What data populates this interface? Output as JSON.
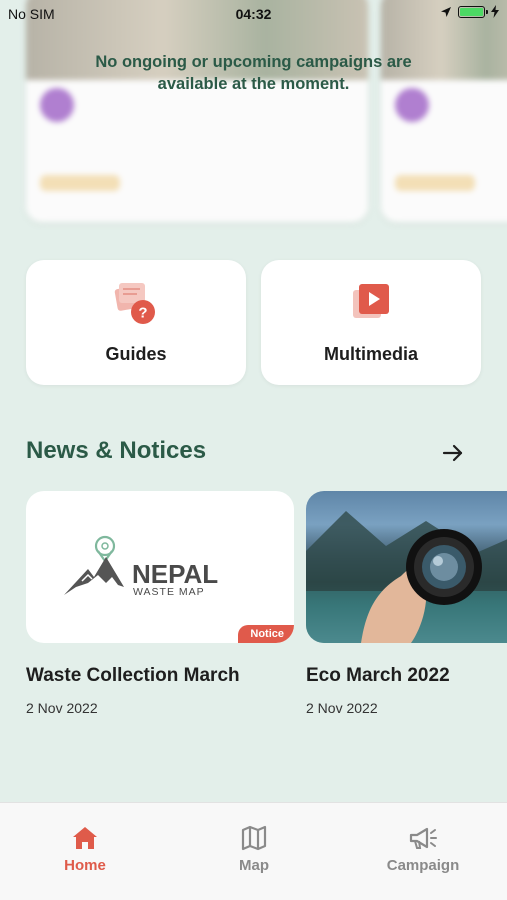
{
  "status_bar": {
    "carrier": "No SIM",
    "time": "04:32",
    "battery_level": 1.0
  },
  "campaigns": {
    "empty_message": "No ongoing or upcoming campaigns are available at the moment."
  },
  "quick_links": [
    {
      "label": "Guides",
      "icon": "guide-question-icon"
    },
    {
      "label": "Multimedia",
      "icon": "video-play-icon"
    }
  ],
  "news": {
    "section_title": "News & Notices",
    "more_icon": "arrow-right-icon",
    "items": [
      {
        "title": "Waste Collection March",
        "date": "2 Nov 2022",
        "badge": "Notice",
        "logo_text": "NEPAL",
        "logo_subtext": "WASTE MAP"
      },
      {
        "title": "Eco March 2022",
        "date": "2 Nov 2022"
      }
    ]
  },
  "bottom_nav": {
    "items": [
      {
        "label": "Home",
        "icon": "home-icon",
        "active": true
      },
      {
        "label": "Map",
        "icon": "map-icon",
        "active": false
      },
      {
        "label": "Campaign",
        "icon": "megaphone-icon",
        "active": false
      }
    ]
  },
  "colors": {
    "background": "#e3efea",
    "heading": "#2b5a47",
    "accent": "#df5b4a",
    "inactive": "#8a8a8a"
  }
}
